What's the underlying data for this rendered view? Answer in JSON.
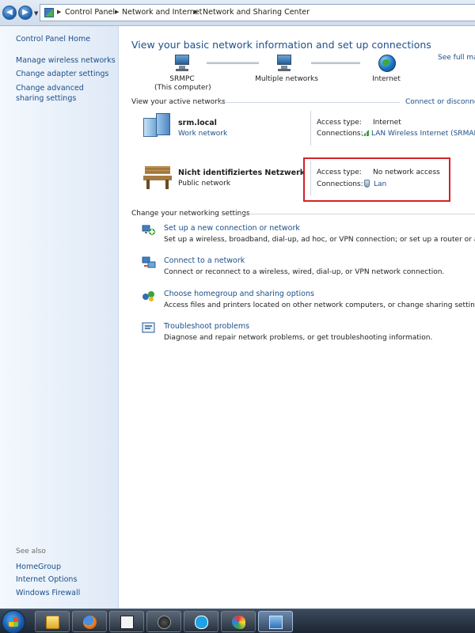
{
  "breadcrumb": [
    "Control Panel",
    "Network and Internet",
    "Network and Sharing Center"
  ],
  "sidebar": {
    "home": "Control Panel Home",
    "links": [
      "Manage wireless networks",
      "Change adapter settings",
      "Change advanced sharing settings"
    ],
    "see_also_heading": "See also",
    "see_also": [
      "HomeGroup",
      "Internet Options",
      "Windows Firewall"
    ]
  },
  "main": {
    "title": "View your basic network information and set up connections",
    "see_full_map": "See full map",
    "map": {
      "computer_name": "SRMPC",
      "computer_sub": "(This computer)",
      "middle": "Multiple networks",
      "internet": "Internet"
    },
    "active_heading": "View your active networks",
    "connect_disconnect": "Connect or disconnect",
    "networks": [
      {
        "name": "srm.local",
        "type": "Work network",
        "access_label": "Access type:",
        "access_value": "Internet",
        "connections_label": "Connections:",
        "connection": "LAN Wireless Internet (SRMAP)"
      },
      {
        "name": "Nicht identifiziertes Netzwerk",
        "type": "Public network",
        "access_label": "Access type:",
        "access_value": "No network access",
        "connections_label": "Connections:",
        "connection": "Lan"
      }
    ],
    "change_heading": "Change your networking settings",
    "tasks": [
      {
        "title": "Set up a new connection or network",
        "desc": "Set up a wireless, broadband, dial-up, ad hoc, or VPN connection; or set up a router or access point."
      },
      {
        "title": "Connect to a network",
        "desc": "Connect or reconnect to a wireless, wired, dial-up, or VPN network connection."
      },
      {
        "title": "Choose homegroup and sharing options",
        "desc": "Access files and printers located on other network computers, or change sharing settings."
      },
      {
        "title": "Troubleshoot problems",
        "desc": "Diagnose and repair network problems, or get troubleshooting information."
      }
    ]
  },
  "taskbar": {
    "items": [
      "windows-explorer",
      "firefox",
      "srm-torque-analysis",
      "srm",
      "skype",
      "paint",
      "network-center"
    ],
    "active_index": 6
  },
  "colors": {
    "link": "#1c4e8a",
    "title": "#1e4f8a",
    "highlight": "#d2232a"
  }
}
